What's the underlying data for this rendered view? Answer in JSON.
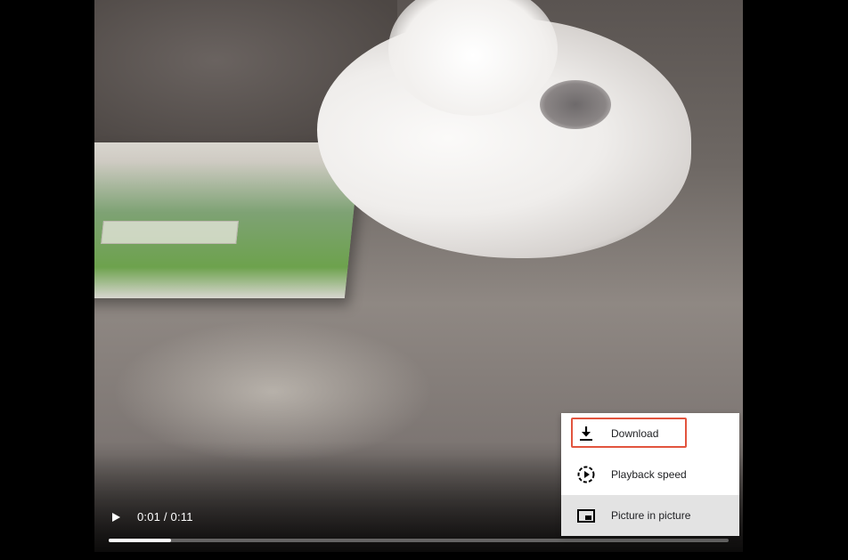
{
  "player": {
    "current_time": "0:01",
    "duration": "0:11",
    "time_text": "0:01 / 0:11",
    "progress_fraction": 0.1,
    "state": "paused"
  },
  "menu": {
    "items": [
      {
        "label": "Download",
        "icon": "download-icon",
        "highlighted": true
      },
      {
        "label": "Playback speed",
        "icon": "playback-speed-icon",
        "highlighted": false
      },
      {
        "label": "Picture in picture",
        "icon": "picture-in-picture-icon",
        "hovered": true
      }
    ]
  },
  "colors": {
    "highlight": "#e2543e",
    "menu_background": "#ffffff",
    "menu_hover": "#e3e3e3",
    "progress_fill": "#ffffff"
  }
}
